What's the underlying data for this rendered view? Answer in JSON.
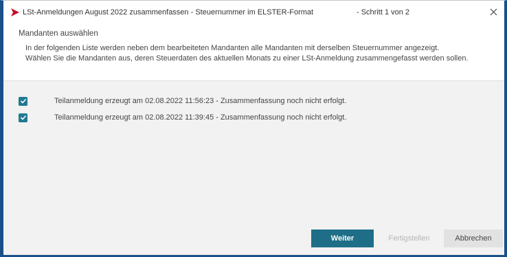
{
  "window": {
    "title": "LSt-Anmeldungen August 2022 zusammenfassen - Steuernummer im ELSTER-Format",
    "step": "- Schritt 1 von 2",
    "close_icon": "close-icon",
    "brand_color": "#c8102e"
  },
  "header": {
    "title": "Mandanten auswählen",
    "description_line1": "In der folgenden Liste werden neben dem bearbeiteten Mandanten alle Mandanten mit derselben Steuernummer angezeigt.",
    "description_line2": "Wählen Sie die Mandanten aus, deren Steuerdaten des aktuellen Monats zu einer LSt-Anmeldung zusammengefasst werden sollen."
  },
  "list": {
    "items": [
      {
        "label": "Teilanmeldung erzeugt am 02.08.2022 11:56:23 - Zusammenfassung noch nicht erfolgt.",
        "checked": true
      },
      {
        "label": "Teilanmeldung erzeugt am 02.08.2022 11:39:45 - Zusammenfassung noch nicht erfolgt.",
        "checked": true
      }
    ],
    "checkbox_color": "#1f7a92"
  },
  "footer": {
    "next_label": "Weiter",
    "finish_label": "Fertigstellen",
    "cancel_label": "Abbrechen",
    "next_color": "#1f6e87"
  }
}
